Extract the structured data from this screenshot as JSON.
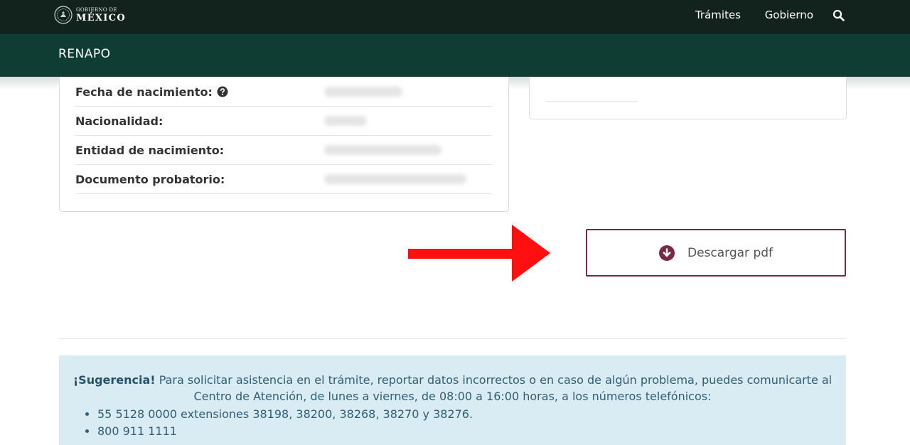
{
  "header": {
    "logo_small": "GOBIERNO DE",
    "logo_big": "MÉXICO",
    "nav_items": [
      "Trámites",
      "Gobierno"
    ],
    "search_icon": "search-icon"
  },
  "subheader": {
    "title": "RENAPO"
  },
  "details": {
    "fields": [
      {
        "label": "Fecha de nacimiento:",
        "has_help_icon": true
      },
      {
        "label": "Nacionalidad:",
        "has_help_icon": false
      },
      {
        "label": "Entidad de nacimiento:",
        "has_help_icon": false
      },
      {
        "label": "Documento probatorio:",
        "has_help_icon": false
      }
    ]
  },
  "download": {
    "label": "Descargar pdf",
    "icon": "arrow-down-circle-icon"
  },
  "suggestion": {
    "title": "¡Sugerencia!",
    "text": "Para solicitar asistencia en el trámite, reportar datos incorrectos o en caso de algún problema, puedes comunicarte al Centro de Atención, de lunes a viernes, de 08:00 a 16:00 horas, a los números telefónicos:",
    "phones": [
      "55 5128 0000 extensiones 38198, 38200, 38268, 38270 y 38276.",
      "800 911 1111"
    ]
  },
  "colors": {
    "topbar": "#12231e",
    "subbar": "#0f3d33",
    "accent": "#7a2945",
    "alert_bg": "#d9ecf3",
    "alert_text": "#315d74",
    "annotation_arrow": "#ff0f0f"
  }
}
